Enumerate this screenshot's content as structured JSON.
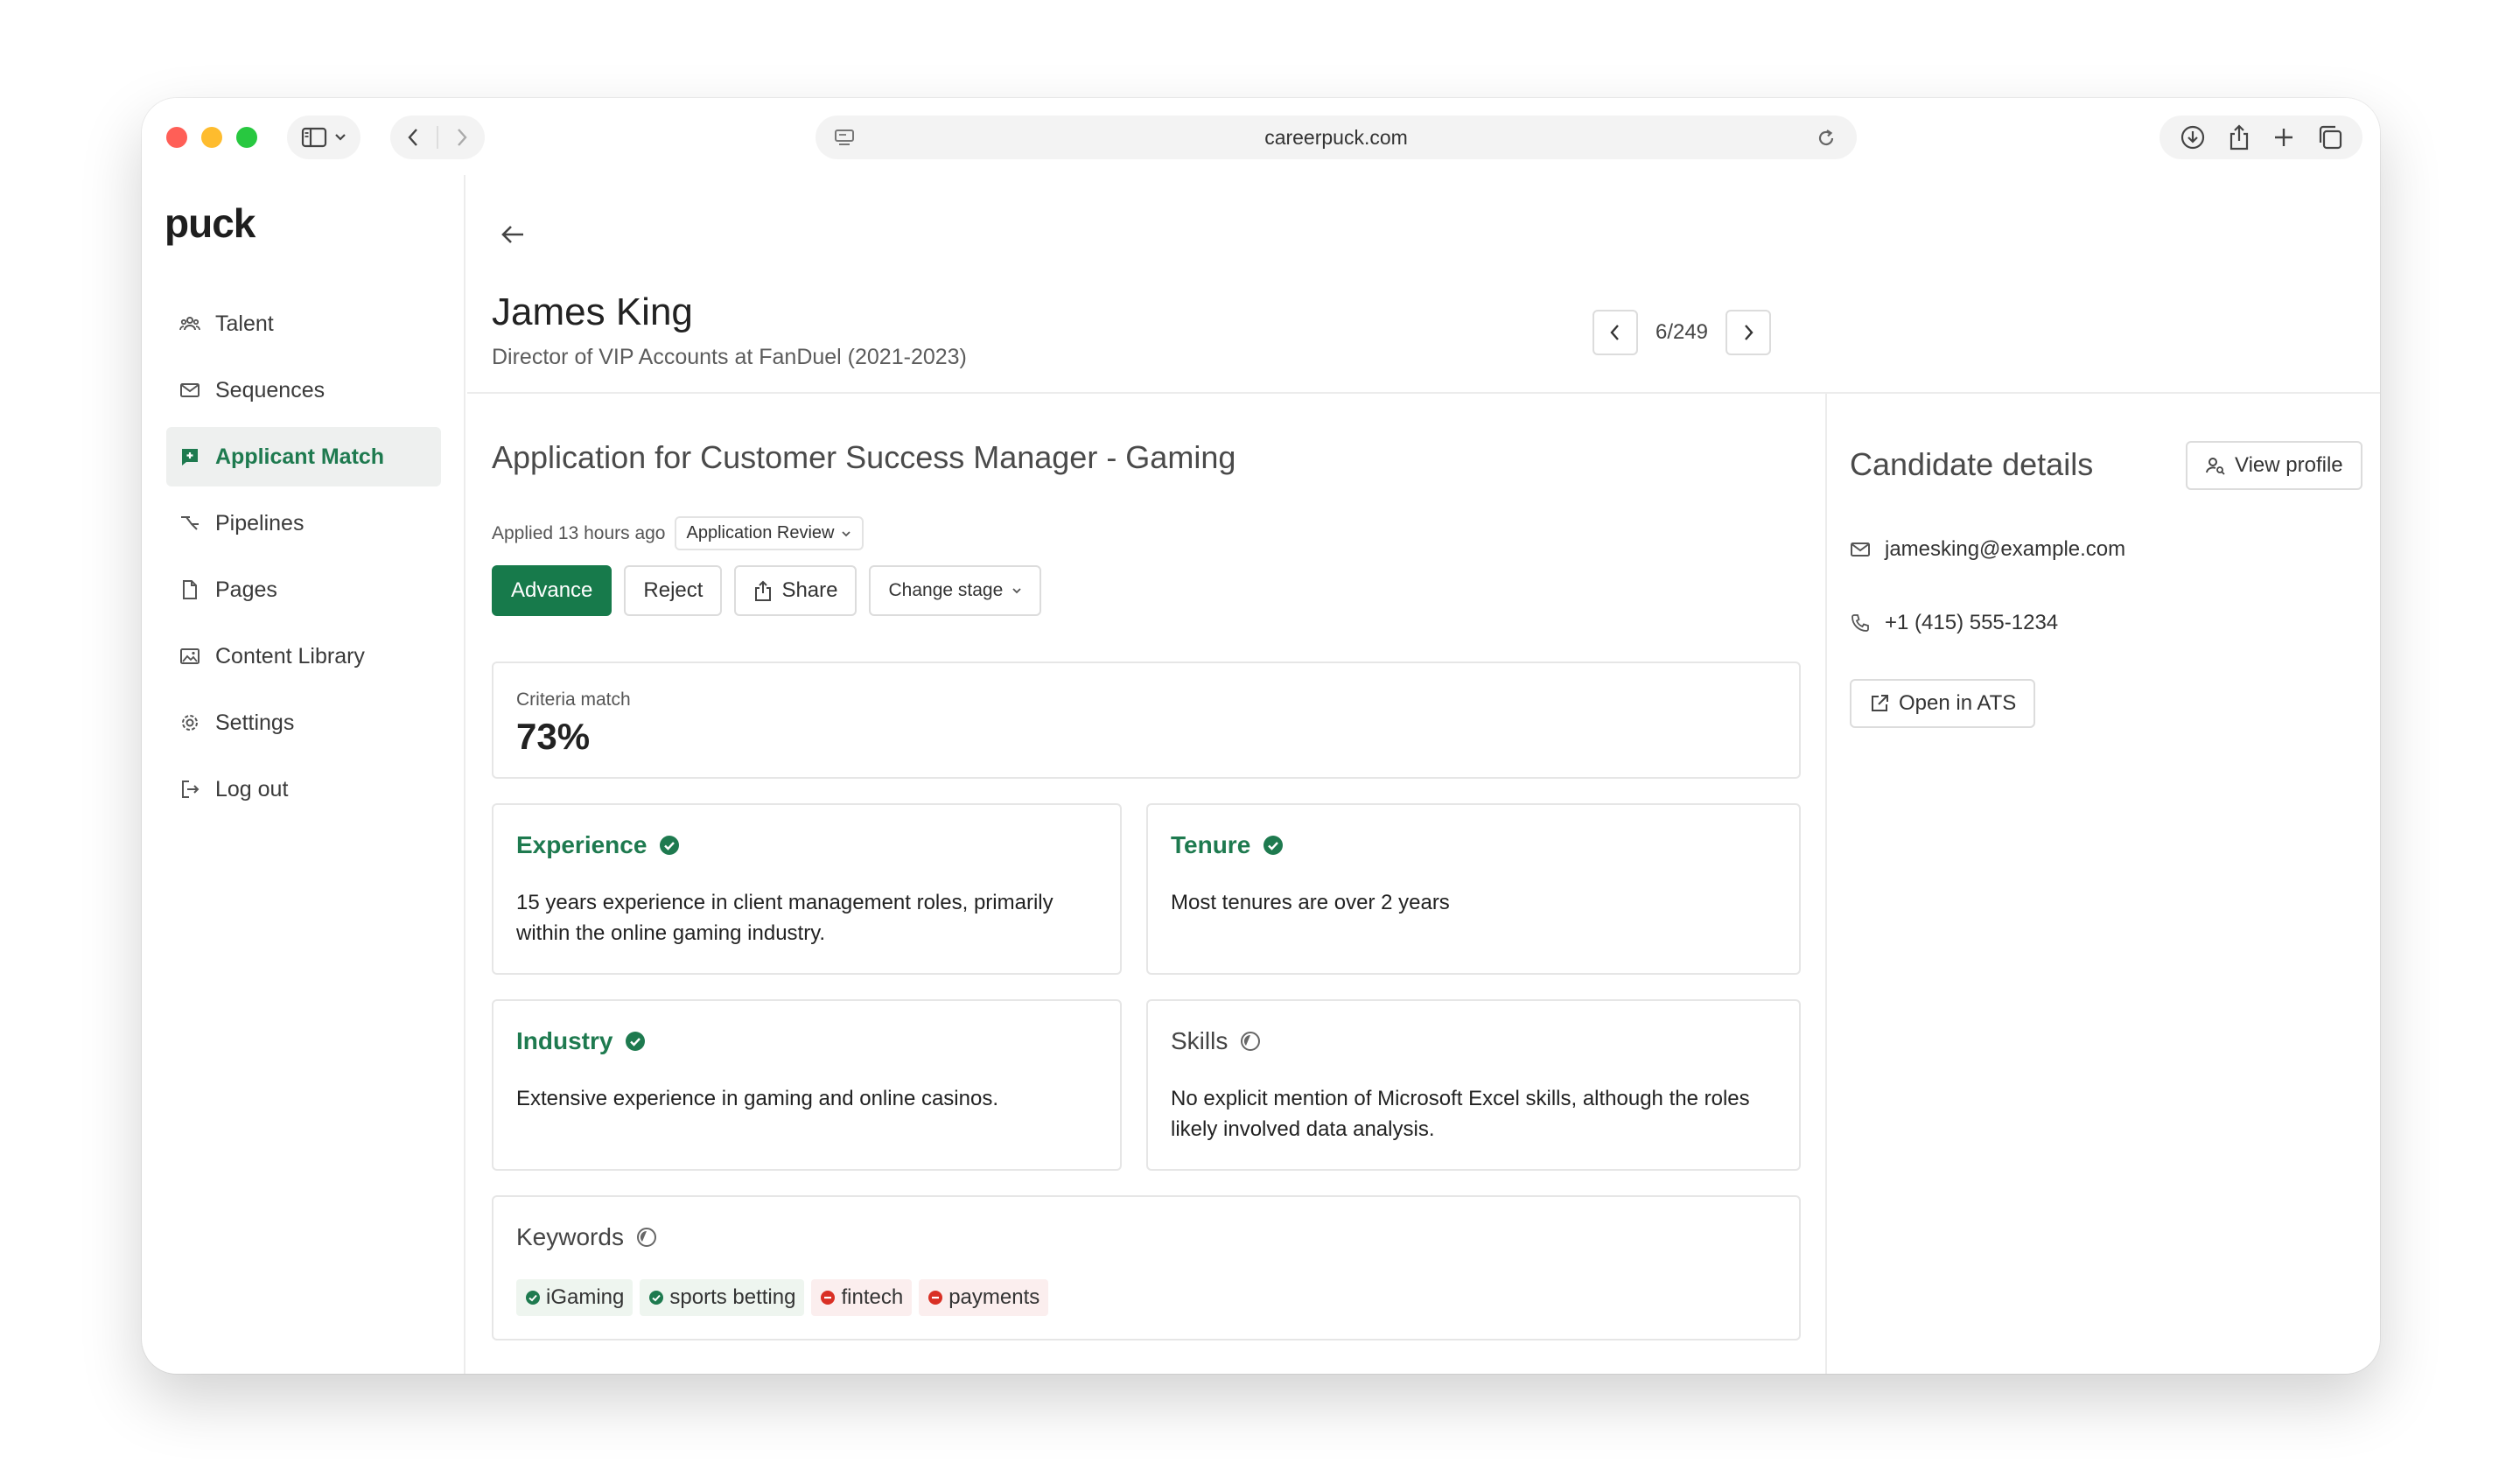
{
  "browser": {
    "url": "careerpuck.com"
  },
  "app": {
    "logo": "puck"
  },
  "sidebar": {
    "items": [
      {
        "label": "Talent",
        "icon": "people-icon",
        "active": false
      },
      {
        "label": "Sequences",
        "icon": "mail-icon",
        "active": false
      },
      {
        "label": "Applicant Match",
        "icon": "match-icon",
        "active": true
      },
      {
        "label": "Pipelines",
        "icon": "pipeline-icon",
        "active": false
      },
      {
        "label": "Pages",
        "icon": "page-icon",
        "active": false
      },
      {
        "label": "Content Library",
        "icon": "image-icon",
        "active": false
      },
      {
        "label": "Settings",
        "icon": "gear-icon",
        "active": false
      },
      {
        "label": "Log out",
        "icon": "logout-icon",
        "active": false
      }
    ]
  },
  "candidate": {
    "name": "James King",
    "subtitle": "Director of VIP Accounts at FanDuel (2021-2023)",
    "pager": "6/249"
  },
  "application": {
    "title": "Application for Customer Success Manager - Gaming",
    "applied": "Applied 13 hours ago",
    "stage": "Application Review",
    "actions": {
      "advance": "Advance",
      "reject": "Reject",
      "share": "Share",
      "change_stage": "Change stage"
    }
  },
  "criteria": {
    "label": "Criteria match",
    "value": "73%"
  },
  "cards": {
    "experience": {
      "title": "Experience",
      "status": "match",
      "body": "15 years experience in client management roles, primarily within the online gaming industry."
    },
    "tenure": {
      "title": "Tenure",
      "status": "match",
      "body": "Most tenures are over 2 years"
    },
    "industry": {
      "title": "Industry",
      "status": "match",
      "body": "Extensive experience in gaming and online casinos."
    },
    "skills": {
      "title": "Skills",
      "status": "partial",
      "body": "No explicit mention of Microsoft Excel skills, although the roles likely involved data analysis."
    }
  },
  "keywords": {
    "title": "Keywords",
    "items": [
      {
        "label": "iGaming",
        "status": "match"
      },
      {
        "label": "sports betting",
        "status": "match"
      },
      {
        "label": "fintech",
        "status": "missing"
      },
      {
        "label": "payments",
        "status": "missing"
      }
    ]
  },
  "details": {
    "title": "Candidate details",
    "view_profile": "View profile",
    "email": "jamesking@example.com",
    "phone": "+1 (415) 555-1234",
    "open_ats": "Open in ATS"
  },
  "colors": {
    "accent": "#177a4b",
    "match": "#1e7a4f",
    "missing": "#d93025",
    "active_bg": "#eef0ef"
  }
}
